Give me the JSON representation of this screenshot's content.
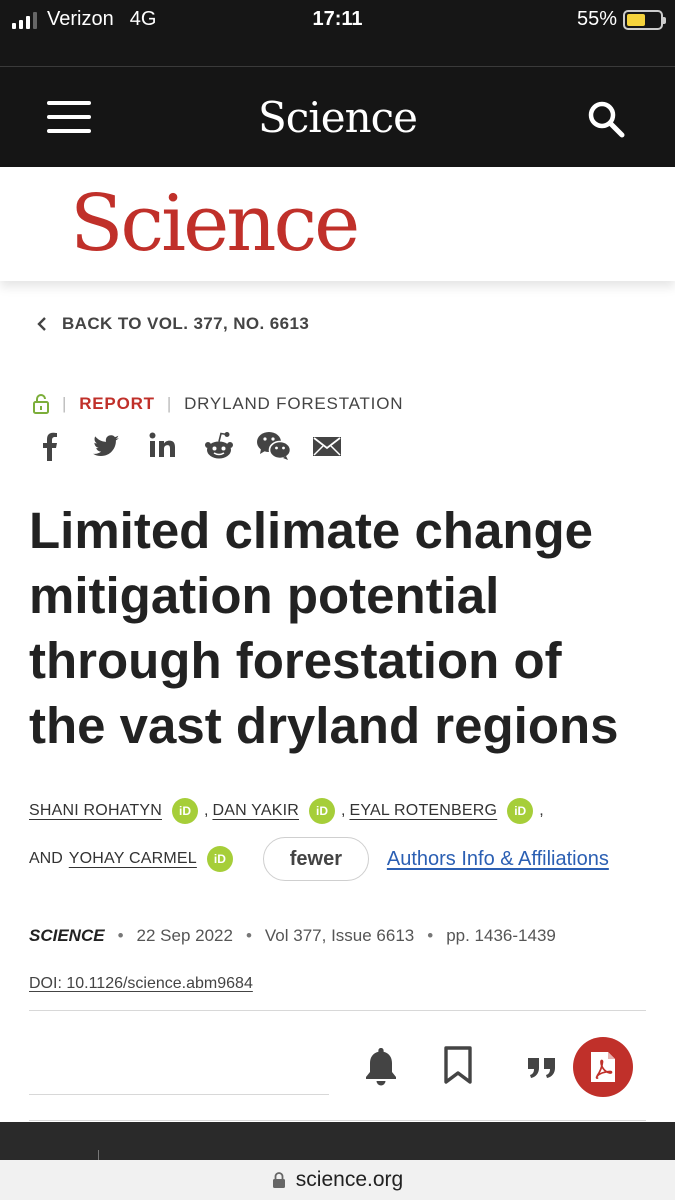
{
  "status_bar": {
    "carrier": "Verizon",
    "network": "4G",
    "time": "17:11",
    "battery": "55%",
    "battery_level": 0.55
  },
  "header": {
    "logo": "Science",
    "menu_icon": "hamburger-icon",
    "search_icon": "search-icon"
  },
  "masthead": {
    "logo": "Science",
    "logo_color": "#c0302a"
  },
  "breadcrumb": {
    "back_label": "BACK TO VOL. 377, NO. 6613"
  },
  "article": {
    "access_icon": "unlock-icon",
    "type": "REPORT",
    "section": "DRYLAND FORESTATION",
    "share_icons": [
      "facebook-icon",
      "twitter-icon",
      "linkedin-icon",
      "reddit-icon",
      "wechat-icon",
      "email-icon"
    ],
    "title": "Limited climate change mitigation potential through forestation of the vast dryland regions",
    "authors": [
      "SHANI ROHATYN",
      "DAN YAKIR",
      "EYAL ROTENBERG",
      "YOHAY CARMEL"
    ],
    "author_separator": ",",
    "and_word": "AND",
    "orcid_label": "iD",
    "fewer_label": "fewer",
    "affiliations_link": "Authors Info & Affiliations",
    "journal": "SCIENCE",
    "date": "22 Sep 2022",
    "volume_issue": "Vol 377, Issue 6613",
    "pages": "pp. 1436-1439",
    "doi": "DOI: 10.1126/science.abm9684"
  },
  "actions": {
    "icons": [
      "bell-icon",
      "bookmark-icon",
      "quote-icon",
      "pdf-icon"
    ]
  },
  "browser": {
    "url": "science.org"
  }
}
